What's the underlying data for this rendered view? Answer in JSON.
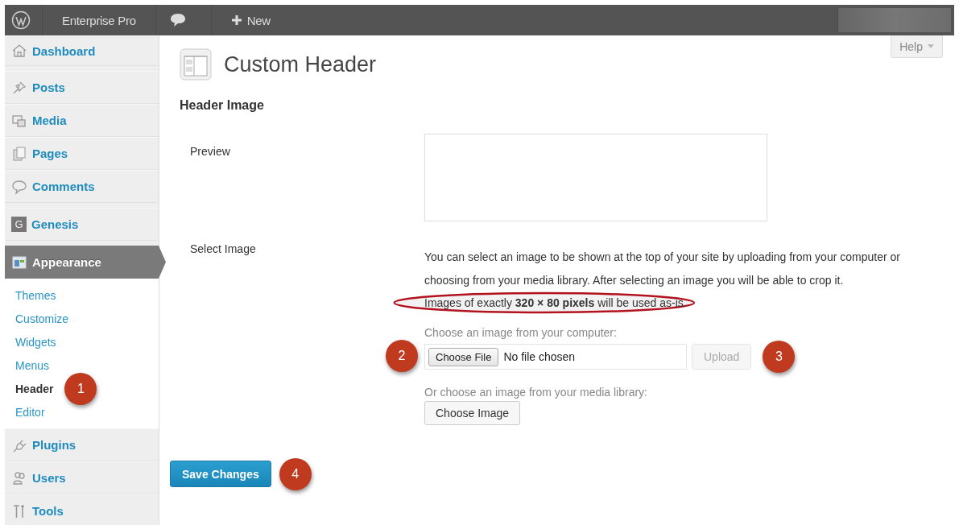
{
  "admin_bar": {
    "site_name": "Enterprise Pro",
    "new_label": "New"
  },
  "sidebar": {
    "items": [
      {
        "label": "Dashboard",
        "selected": false
      },
      {
        "label": "Posts",
        "selected": false
      },
      {
        "label": "Media",
        "selected": false
      },
      {
        "label": "Pages",
        "selected": false
      },
      {
        "label": "Comments",
        "selected": false
      },
      {
        "label": "Genesis",
        "selected": false,
        "badge_letter": "G"
      },
      {
        "label": "Appearance",
        "selected": true,
        "children": [
          {
            "label": "Themes",
            "selected": false
          },
          {
            "label": "Customize",
            "selected": false
          },
          {
            "label": "Widgets",
            "selected": false
          },
          {
            "label": "Menus",
            "selected": false
          },
          {
            "label": "Header",
            "selected": true,
            "annotation": "1"
          },
          {
            "label": "Editor",
            "selected": false
          }
        ]
      },
      {
        "label": "Plugins",
        "selected": false
      },
      {
        "label": "Users",
        "selected": false
      },
      {
        "label": "Tools",
        "selected": false
      }
    ]
  },
  "help_tab": "Help",
  "page_title": "Custom Header",
  "section_title": "Header Image",
  "preview": {
    "label": "Preview"
  },
  "select_image": {
    "label": "Select Image",
    "description": "You can select an image to be shown at the top of your site by uploading from your computer or choosing from your media library. After selecting an image you will be able to crop it.",
    "note": "Images of exactly **320 × 80 pixels** will be used as-is.",
    "note_highlighted": true,
    "computer_label": "Choose an image from your computer:",
    "choose_file": {
      "label": "Choose File",
      "annotation": "2"
    },
    "file_status": "No file chosen",
    "upload": {
      "label": "Upload",
      "disabled": true,
      "annotation": "3"
    },
    "library_label": "Or choose an image from your media library:",
    "choose_image": "Choose Image"
  },
  "save": {
    "label": "Save Changes",
    "annotation": "4"
  }
}
